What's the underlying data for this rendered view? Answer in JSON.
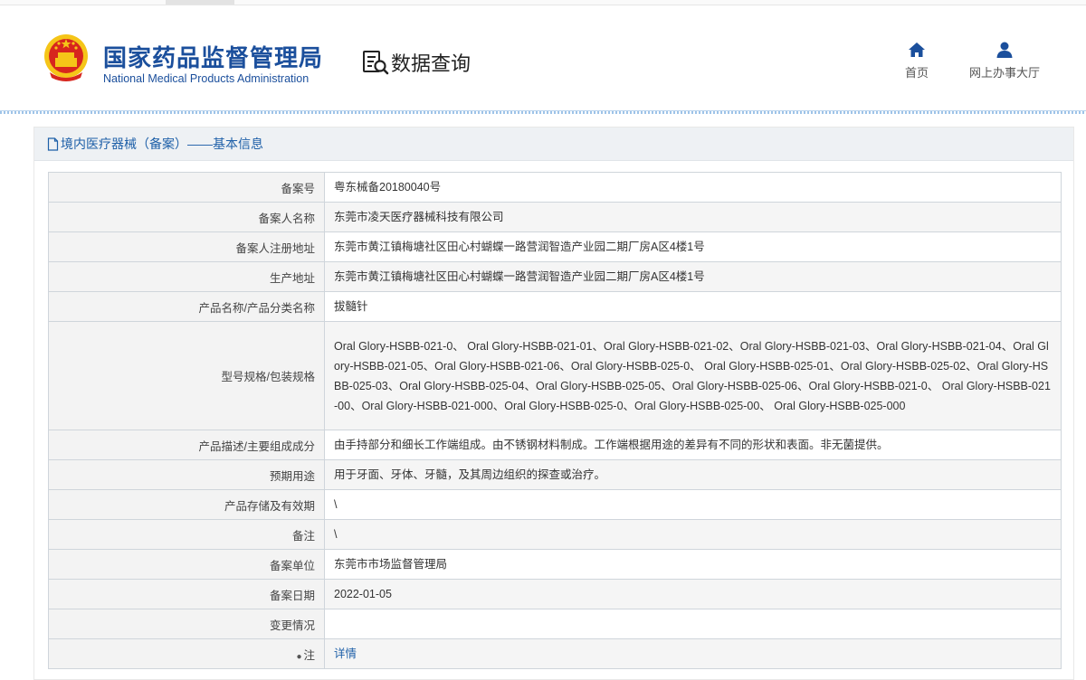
{
  "header": {
    "agency_cn": "国家药品监督管理局",
    "agency_en": "National Medical Products Administration",
    "section": "数据查询",
    "nav": [
      {
        "label": "首页",
        "icon": "home-icon"
      },
      {
        "label": "网上办事大厅",
        "icon": "user-icon"
      }
    ]
  },
  "panel": {
    "title": "境内医疗器械（备案）——基本信息"
  },
  "record": {
    "rows": [
      {
        "label": "备案号",
        "value": "粤东械备20180040号"
      },
      {
        "label": "备案人名称",
        "value": "东莞市凌天医疗器械科技有限公司"
      },
      {
        "label": "备案人注册地址",
        "value": "东莞市黄江镇梅塘社区田心村蝴蝶一路营润智造产业园二期厂房A区4楼1号"
      },
      {
        "label": "生产地址",
        "value": "东莞市黄江镇梅塘社区田心村蝴蝶一路营润智造产业园二期厂房A区4楼1号"
      },
      {
        "label": "产品名称/产品分类名称",
        "value": "拔髓针"
      },
      {
        "label": "型号规格/包装规格",
        "value": "Oral Glory-HSBB-021-0、 Oral Glory-HSBB-021-01、Oral Glory-HSBB-021-02、Oral Glory-HSBB-021-03、Oral Glory-HSBB-021-04、Oral Glory-HSBB-021-05、Oral Glory-HSBB-021-06、Oral Glory-HSBB-025-0、 Oral Glory-HSBB-025-01、Oral Glory-HSBB-025-02、Oral Glory-HSBB-025-03、Oral Glory-HSBB-025-04、Oral Glory-HSBB-025-05、Oral Glory-HSBB-025-06、Oral Glory-HSBB-021-0、 Oral Glory-HSBB-021-00、Oral Glory-HSBB-021-000、Oral Glory-HSBB-025-0、Oral Glory-HSBB-025-00、 Oral Glory-HSBB-025-000"
      },
      {
        "label": "产品描述/主要组成成分",
        "value": "由手持部分和细长工作端组成。由不锈钢材料制成。工作端根据用途的差异有不同的形状和表面。非无菌提供。"
      },
      {
        "label": "预期用途",
        "value": "用于牙面、牙体、牙髓，及其周边组织的探查或治疗。"
      },
      {
        "label": "产品存储及有效期",
        "value": "\\"
      },
      {
        "label": "备注",
        "value": "\\"
      },
      {
        "label": "备案单位",
        "value": "东莞市市场监督管理局"
      },
      {
        "label": "备案日期",
        "value": "2022-01-05"
      },
      {
        "label": "变更情况",
        "value": ""
      },
      {
        "label": "注",
        "value": "详情"
      }
    ]
  },
  "colors": {
    "brand_blue": "#1b4f9c",
    "link_blue": "#1d5fa8",
    "emblem_red": "#d7261e",
    "emblem_gold": "#f5c518"
  }
}
